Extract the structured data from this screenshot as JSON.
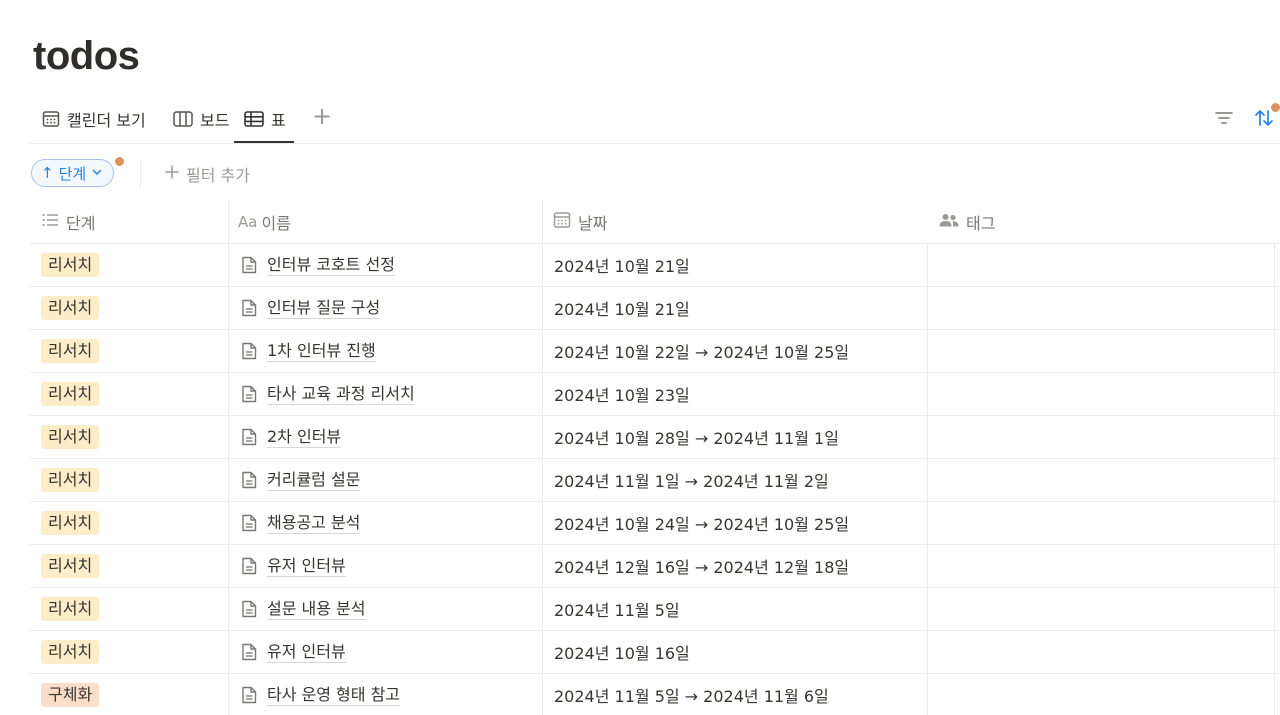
{
  "page": {
    "title": "todos"
  },
  "views": {
    "tabs": [
      {
        "label": "캘린더 보기",
        "icon": "calendar-icon",
        "active": false
      },
      {
        "label": "보드",
        "icon": "board-icon",
        "active": false
      },
      {
        "label": "표",
        "icon": "table-icon",
        "active": true
      }
    ],
    "add_view_label": "+"
  },
  "toolbar": {
    "filter_icon": "filter-icon",
    "sort_icon": "sort-icon",
    "indicator_color": "#d9935f"
  },
  "filters": {
    "sort_chip": {
      "arrow": "↑",
      "label": "단계",
      "color": "#2383e2"
    },
    "add_filter_label": "필터 추가"
  },
  "table": {
    "columns": [
      {
        "label": "단계",
        "icon": "list-icon"
      },
      {
        "label": "이름",
        "icon": "text-aa-icon",
        "icon_text": "Aa"
      },
      {
        "label": "날짜",
        "icon": "calendar-icon"
      },
      {
        "label": "태그",
        "icon": "people-icon"
      }
    ],
    "rows": [
      {
        "stage": "리서치",
        "stage_color": "#fdecc8",
        "name": "인터뷰 코호트 선정",
        "date": "2024년 10월 21일"
      },
      {
        "stage": "리서치",
        "stage_color": "#fdecc8",
        "name": "인터뷰 질문 구성",
        "date": "2024년 10월 21일"
      },
      {
        "stage": "리서치",
        "stage_color": "#fdecc8",
        "name": "1차 인터뷰 진행",
        "date": "2024년 10월 22일 → 2024년 10월 25일"
      },
      {
        "stage": "리서치",
        "stage_color": "#fdecc8",
        "name": "타사 교육 과정 리서치",
        "date": "2024년 10월 23일"
      },
      {
        "stage": "리서치",
        "stage_color": "#fdecc8",
        "name": "2차 인터뷰",
        "date": "2024년 10월 28일 → 2024년 11월 1일"
      },
      {
        "stage": "리서치",
        "stage_color": "#fdecc8",
        "name": "커리큘럼 설문",
        "date": "2024년 11월 1일 → 2024년 11월 2일"
      },
      {
        "stage": "리서치",
        "stage_color": "#fdecc8",
        "name": "채용공고 분석",
        "date": "2024년 10월 24일 → 2024년 10월 25일"
      },
      {
        "stage": "리서치",
        "stage_color": "#fdecc8",
        "name": "유저 인터뷰",
        "date": "2024년 12월 16일 → 2024년 12월 18일"
      },
      {
        "stage": "리서치",
        "stage_color": "#fdecc8",
        "name": "설문 내용 분석",
        "date": "2024년 11월 5일"
      },
      {
        "stage": "리서치",
        "stage_color": "#fdecc8",
        "name": "유저 인터뷰",
        "date": "2024년 10월 16일"
      },
      {
        "stage": "구체화",
        "stage_color": "#fadec9",
        "name": "타사 운영 형태 참고",
        "date": "2024년 11월 5일 → 2024년 11월 6일"
      }
    ]
  }
}
